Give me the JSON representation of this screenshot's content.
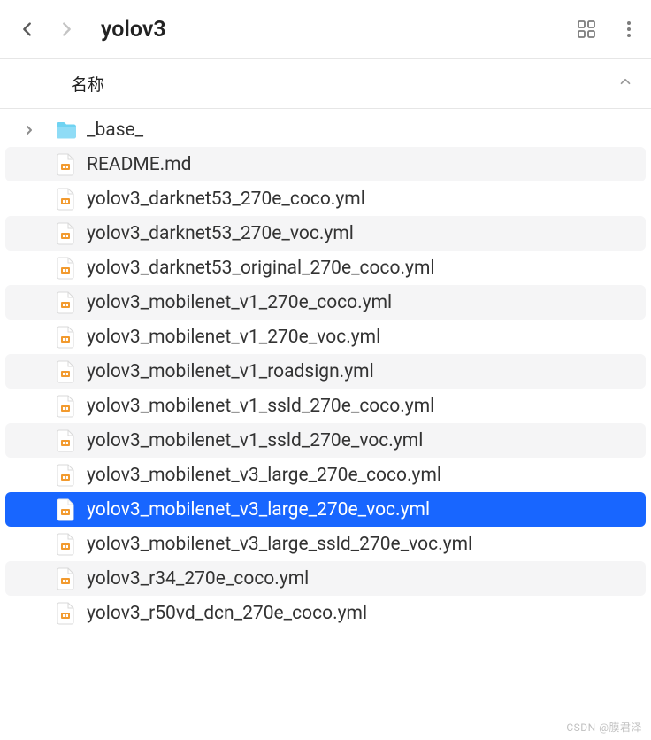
{
  "toolbar": {
    "title": "yolov3"
  },
  "header": {
    "name_label": "名称"
  },
  "items": [
    {
      "type": "folder",
      "name": "_base_",
      "has_disclosure": true
    },
    {
      "type": "md",
      "name": "README.md"
    },
    {
      "type": "yml",
      "name": "yolov3_darknet53_270e_coco.yml"
    },
    {
      "type": "yml",
      "name": "yolov3_darknet53_270e_voc.yml"
    },
    {
      "type": "yml",
      "name": "yolov3_darknet53_original_270e_coco.yml"
    },
    {
      "type": "yml",
      "name": "yolov3_mobilenet_v1_270e_coco.yml"
    },
    {
      "type": "yml",
      "name": "yolov3_mobilenet_v1_270e_voc.yml"
    },
    {
      "type": "yml",
      "name": "yolov3_mobilenet_v1_roadsign.yml"
    },
    {
      "type": "yml",
      "name": "yolov3_mobilenet_v1_ssld_270e_coco.yml"
    },
    {
      "type": "yml",
      "name": "yolov3_mobilenet_v1_ssld_270e_voc.yml"
    },
    {
      "type": "yml",
      "name": "yolov3_mobilenet_v3_large_270e_coco.yml"
    },
    {
      "type": "yml",
      "name": "yolov3_mobilenet_v3_large_270e_voc.yml",
      "selected": true
    },
    {
      "type": "yml",
      "name": "yolov3_mobilenet_v3_large_ssld_270e_voc.yml"
    },
    {
      "type": "yml",
      "name": "yolov3_r34_270e_coco.yml"
    },
    {
      "type": "yml",
      "name": "yolov3_r50vd_dcn_270e_coco.yml"
    }
  ],
  "watermark": "CSDN @膜君泽"
}
